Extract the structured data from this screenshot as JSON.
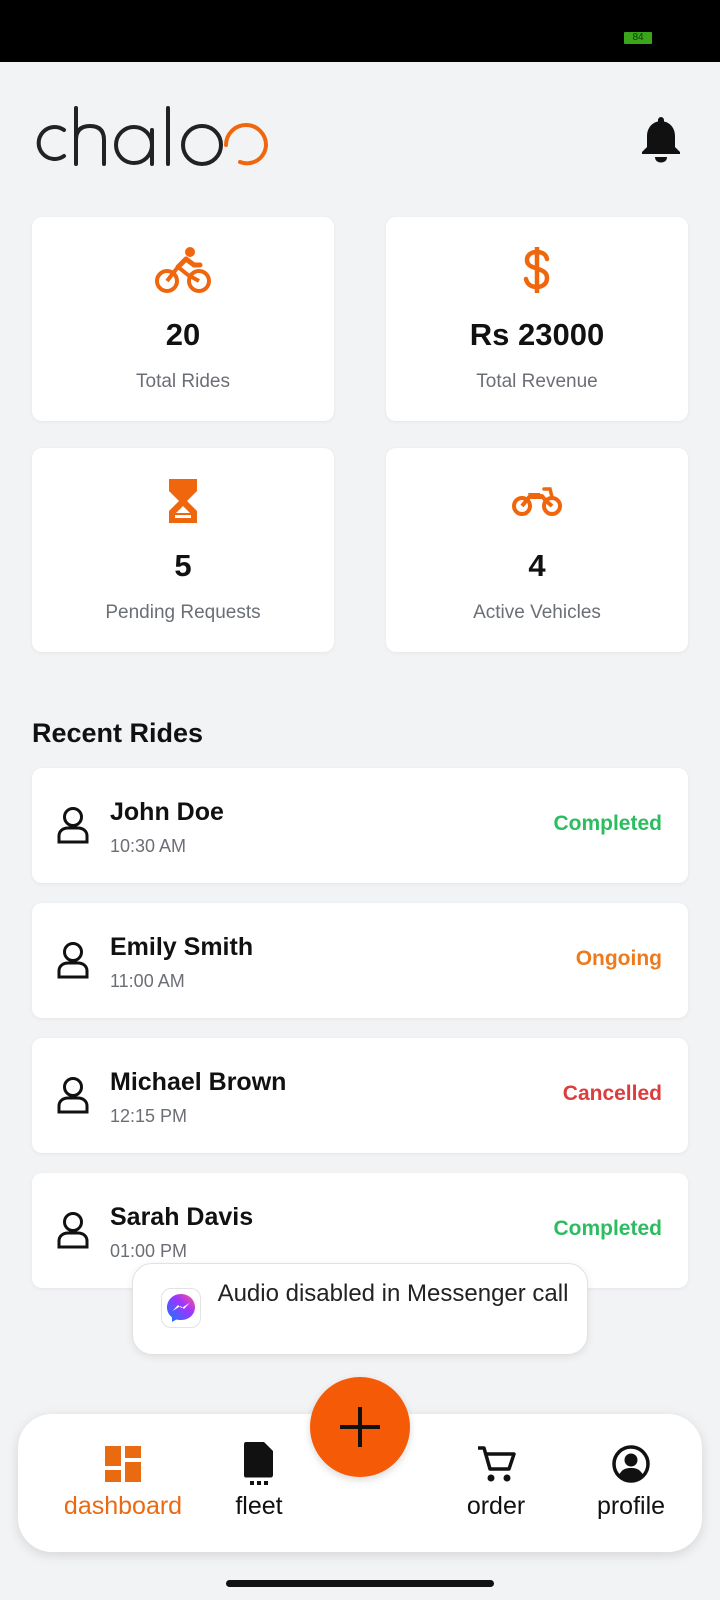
{
  "status_bar": {
    "battery": "84"
  },
  "header": {
    "logo_text": "chaloo"
  },
  "stats": [
    {
      "icon": "bicycle-icon",
      "value": "20",
      "label": "Total Rides"
    },
    {
      "icon": "dollar-icon",
      "value": "Rs 23000",
      "label": "Total Revenue"
    },
    {
      "icon": "hourglass-icon",
      "value": "5",
      "label": "Pending Requests"
    },
    {
      "icon": "motorcycle-icon",
      "value": "4",
      "label": "Active Vehicles"
    }
  ],
  "recent_rides": {
    "title": "Recent Rides",
    "items": [
      {
        "name": "John Doe",
        "time": "10:30 AM",
        "status": "Completed"
      },
      {
        "name": "Emily Smith",
        "time": "11:00 AM",
        "status": "Ongoing"
      },
      {
        "name": "Michael Brown",
        "time": "12:15 PM",
        "status": "Cancelled"
      },
      {
        "name": "Sarah Davis",
        "time": "01:00 PM",
        "status": "Completed"
      }
    ]
  },
  "toast": {
    "text": "Audio disabled in Messenger call",
    "app_icon": "messenger-icon"
  },
  "bottom_nav": {
    "items": [
      {
        "label": "dashboard",
        "icon": "dashboard-icon",
        "active": true
      },
      {
        "label": "fleet",
        "icon": "document-icon",
        "active": false
      },
      {
        "label": "order",
        "icon": "cart-icon",
        "active": false
      },
      {
        "label": "profile",
        "icon": "account-circle-icon",
        "active": false
      }
    ],
    "fab_icon": "plus-icon"
  },
  "colors": {
    "accent": "#f55a06",
    "completed": "#2bbd5f",
    "ongoing": "#ee7a1e",
    "cancelled": "#dc3d3d"
  }
}
